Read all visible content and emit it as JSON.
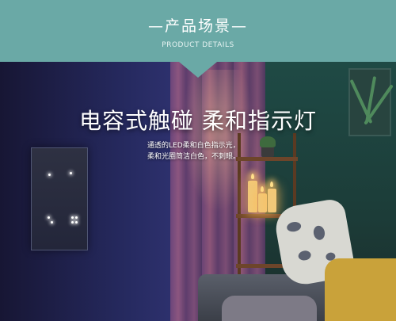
{
  "header": {
    "title": "—产品场景—",
    "subtitle": "PRODUCT DETAILS"
  },
  "hero": {
    "headline": "电容式触碰 柔和指示灯",
    "description_lines": [
      "通透的LED柔和白色指示光，",
      "柔和光圈简洁白色，不刺眼。"
    ]
  },
  "colors": {
    "header_bg": "#6aa9a6",
    "text": "#ffffff"
  }
}
